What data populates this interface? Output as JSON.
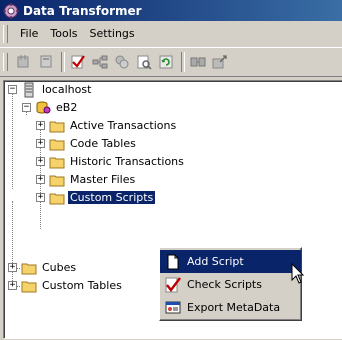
{
  "window": {
    "title": "Data Transformer"
  },
  "menubar": {
    "items": [
      "File",
      "Tools",
      "Settings"
    ]
  },
  "toolbar": {
    "buttons": [
      "new-icon",
      "open-icon",
      "check-icon",
      "network-icon",
      "people-icon",
      "preview-icon",
      "refresh-icon",
      "build-icon",
      "export-icon"
    ]
  },
  "tree": {
    "server": "localhost",
    "database": "eB2",
    "folders": [
      "Active Transactions",
      "Code Tables",
      "Historic Transactions",
      "Master Files",
      "Custom Scripts"
    ],
    "root_folders": [
      "Cubes",
      "Custom Tables"
    ],
    "selected": "Custom Scripts"
  },
  "context_menu": {
    "items": [
      {
        "label": "Add Script",
        "icon": "page-icon",
        "highlighted": true
      },
      {
        "label": "Check Scripts",
        "icon": "checkmark-icon",
        "highlighted": false
      },
      {
        "label": "Export MetaData",
        "icon": "export-icon",
        "highlighted": false
      }
    ]
  },
  "colors": {
    "highlight": "#0a246a",
    "folder": "#f5d26a",
    "face": "#d4d0c8"
  }
}
